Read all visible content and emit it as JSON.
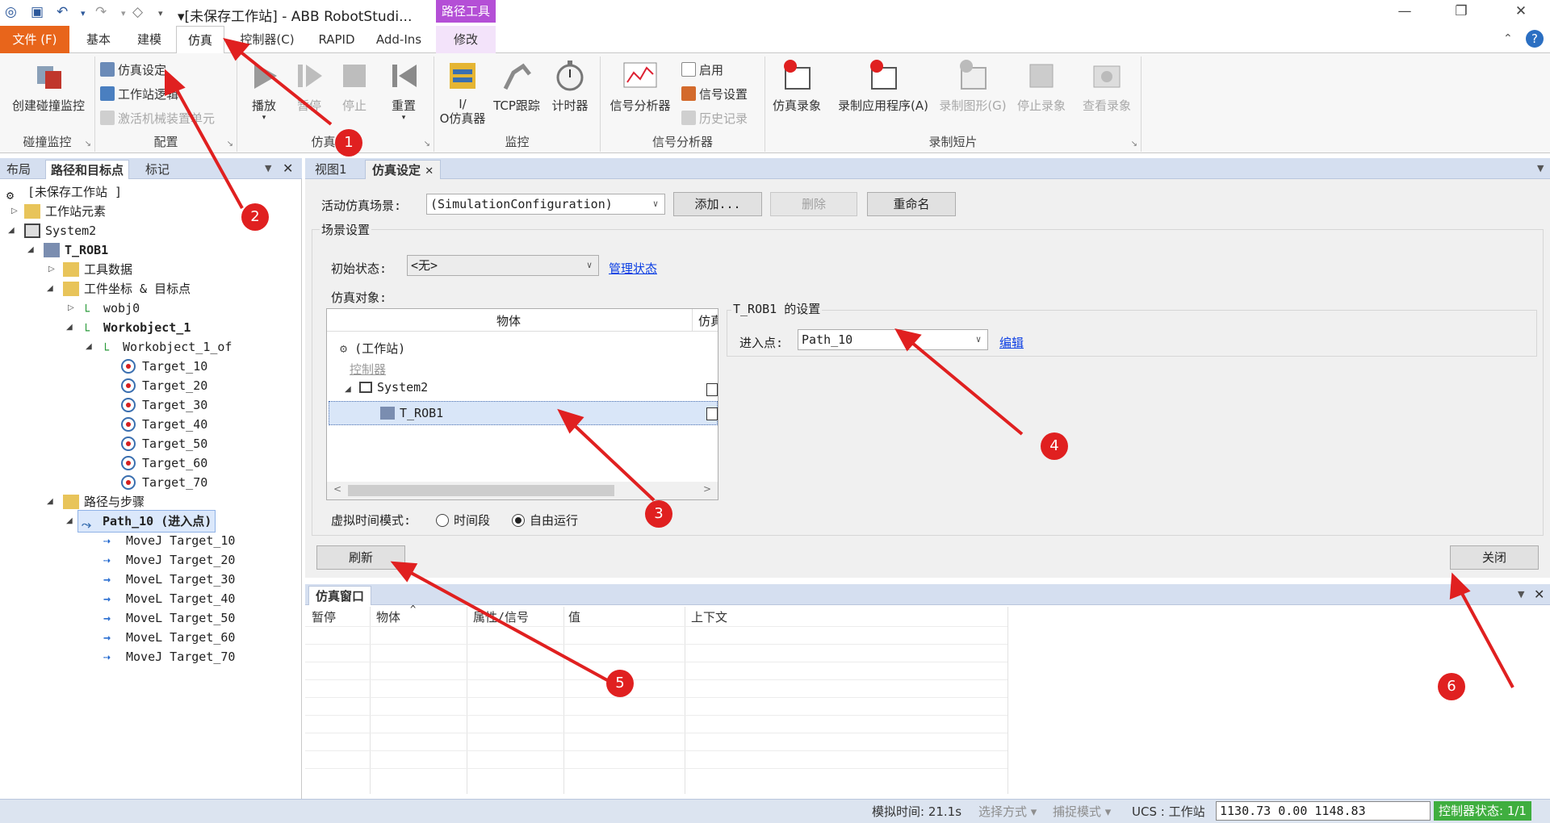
{
  "titlebar": {
    "title": "▾[未保存工作站] - ABB RobotStudi...",
    "context_tab_group": "路径工具"
  },
  "ribbon_tabs": [
    "文件 (F)",
    "基本",
    "建模",
    "仿真",
    "控制器(C)",
    "RAPID",
    "Add-Ins",
    "修改"
  ],
  "ribbon": {
    "collision": {
      "button": "创建碰撞监控",
      "title": "碰撞监控"
    },
    "config": {
      "items": [
        "仿真设定",
        "工作站逻辑",
        "激活机械装置单元"
      ],
      "title": "配置"
    },
    "simcontrol": {
      "buttons": [
        "播放",
        "暂停",
        "停止",
        "重置"
      ],
      "title": "仿真控制"
    },
    "monitor": {
      "buttons": [
        "I/\nO仿真器",
        "TCP跟踪",
        "计时器"
      ],
      "title": "监控"
    },
    "signal": {
      "button": "信号分析器",
      "items": [
        "启用",
        "信号设置",
        "历史记录"
      ],
      "title": "信号分析器"
    },
    "record": {
      "buttons": [
        "仿真录象",
        "录制应用程序(A)",
        "录制图形(G)",
        "停止录象",
        "查看录象"
      ],
      "title": "录制短片"
    }
  },
  "leftpanel": {
    "tabs": [
      "布局",
      "路径和目标点",
      "标记"
    ],
    "tree": {
      "station": "[未保存工作站 ]",
      "station_elements": "工作站元素",
      "system": "System2",
      "task": "T_ROB1",
      "tooldata": "工具数据",
      "wobj_targets": "工件坐标 & 目标点",
      "wobj0": "wobj0",
      "workobject": "Workobject_1",
      "workobject_of": "Workobject_1_of",
      "targets": [
        "Target_10",
        "Target_20",
        "Target_30",
        "Target_40",
        "Target_50",
        "Target_60",
        "Target_70"
      ],
      "paths_procs": "路径与步骤",
      "path": "Path_10 (进入点)",
      "moves": [
        "MoveJ Target_10",
        "MoveJ Target_20",
        "MoveL Target_30",
        "MoveL Target_40",
        "MoveL Target_50",
        "MoveL Target_60",
        "MoveJ Target_70"
      ]
    }
  },
  "docpanel": {
    "tabs": [
      "视图1",
      "仿真设定"
    ],
    "active_scenario_label": "活动仿真场景:",
    "active_scenario_value": "(SimulationConfiguration)",
    "add_button": "添加...",
    "delete_button": "删除",
    "rename_button": "重命名",
    "scene_settings": "场景设置",
    "initial_state_label": "初始状态:",
    "initial_state_value": "<无>",
    "manage_state_link": "管理状态",
    "sim_objects_label": "仿真对象:",
    "col_object": "物体",
    "col_sim": "仿真",
    "obj_station": "(工作站)",
    "obj_controller": "控制器",
    "obj_system": "System2",
    "obj_task": "T_ROB1",
    "task_settings": "T_ROB1 的设置",
    "entry_label": "进入点:",
    "entry_value": "Path_10",
    "edit_link": "编辑",
    "virtual_time_label": "虚拟时间模式:",
    "radio_timeslice": "时间段",
    "radio_freerun": "自由运行",
    "refresh_button": "刷新",
    "close_button": "关闭"
  },
  "simwindow": {
    "title": "仿真窗口",
    "columns": [
      "暂停",
      "物体",
      "属性/信号",
      "值",
      "上下文"
    ]
  },
  "statusbar": {
    "sim_time": "模拟时间: 21.1s",
    "select_mode": "选择方式 ▾",
    "snap_mode": "捕捉模式 ▾",
    "ucs": "UCS : 工作站",
    "coords": "1130.73  0.00  1148.83",
    "controller_status": "控制器状态: 1/1"
  },
  "annotations": [
    "1",
    "2",
    "3",
    "4",
    "5",
    "6"
  ],
  "colors": {
    "file_tab": "#e8651b",
    "context_tab": "#b44fd6",
    "marker": "#e02020",
    "link": "#0b3ee3"
  }
}
